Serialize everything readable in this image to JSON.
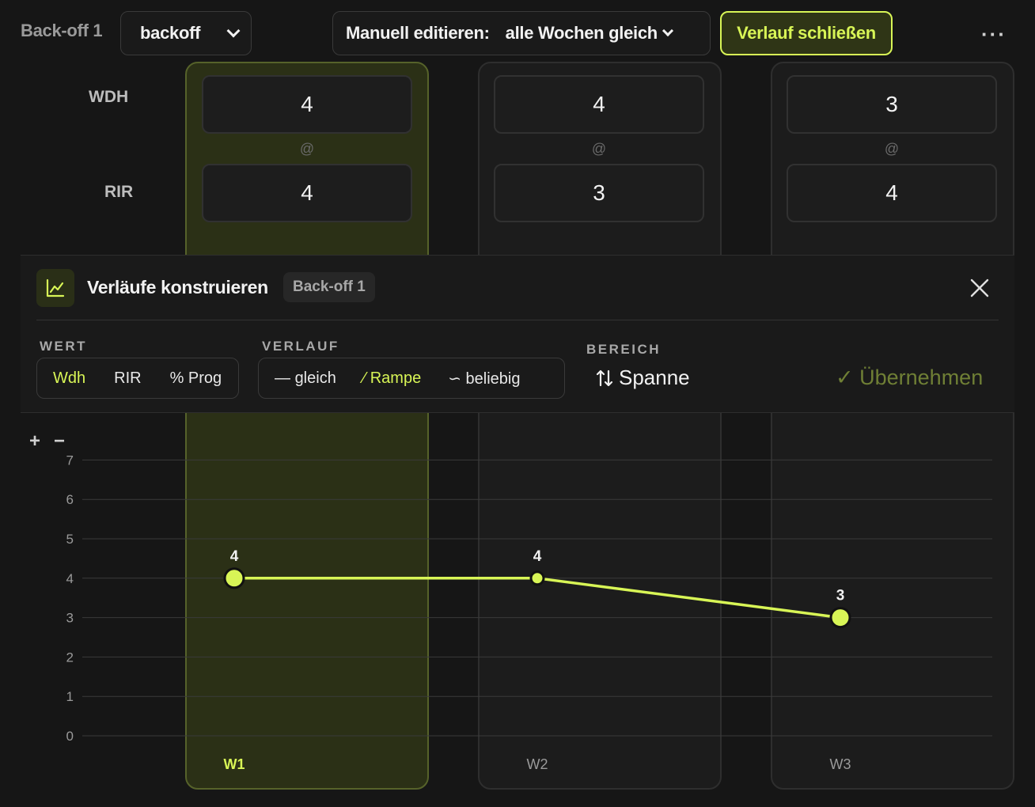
{
  "toolbar": {
    "set_label": "Back-off 1",
    "set_type_value": "backoff",
    "edit_mode_label": "Manuell editieren:",
    "edit_mode_value": "alle Wochen gleich",
    "close_history_label": "Verlauf schließen",
    "more_label": "···"
  },
  "rows": {
    "reps_label": "WDH",
    "rir_label": "RIR",
    "separator": "@"
  },
  "weeks": [
    {
      "label": "W1",
      "reps": "4",
      "rir": "4",
      "active": true
    },
    {
      "label": "W2",
      "reps": "4",
      "rir": "3",
      "active": false
    },
    {
      "label": "W3",
      "reps": "3",
      "rir": "4",
      "active": false
    }
  ],
  "builder": {
    "title": "Verläufe konstruieren",
    "badge": "Back-off 1",
    "wert_label": "WERT",
    "wert_options": [
      "Wdh",
      "RIR",
      "% Prog"
    ],
    "wert_selected": "Wdh",
    "verlauf_label": "VERLAUF",
    "verlauf_options": [
      {
        "icon": "—",
        "label": "gleich"
      },
      {
        "icon": "⁄",
        "label": "Rampe"
      },
      {
        "icon": "∽",
        "label": "beliebig"
      }
    ],
    "verlauf_selected": "Rampe",
    "bereich_label": "BEREICH",
    "bereich_value": "Spanne",
    "apply_label": "✓ Übernehmen"
  },
  "zoom": {
    "plus": "+",
    "minus": "−"
  },
  "colors": {
    "accent": "#d8f556",
    "background": "#161616",
    "active_column": "#2b3016"
  },
  "chart_data": {
    "type": "line",
    "categories": [
      "W1",
      "W2",
      "W3"
    ],
    "series": [
      {
        "values": [
          4,
          4,
          3
        ]
      }
    ],
    "data_labels": [
      "4",
      "4",
      "3"
    ],
    "y_ticks": [
      "0",
      "1",
      "2",
      "3",
      "4",
      "5",
      "6",
      "7"
    ],
    "ylim": [
      0,
      7
    ],
    "grid": true,
    "active_category": "W1"
  }
}
